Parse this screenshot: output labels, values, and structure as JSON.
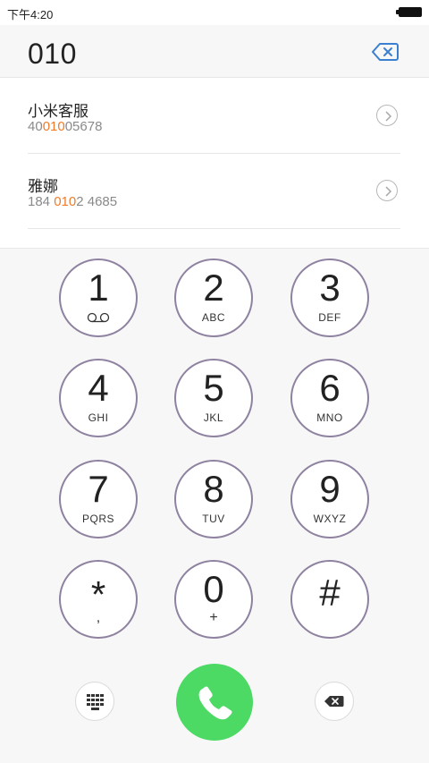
{
  "status_bar": {
    "time": "下午4:20"
  },
  "header": {
    "entered_number": "010"
  },
  "results": [
    {
      "name": "小米客服",
      "number_parts": [
        "40",
        "010",
        "05678"
      ]
    },
    {
      "name": "雅娜",
      "number_parts": [
        "184 ",
        "010",
        "2 4685"
      ]
    }
  ],
  "keypad": {
    "keys": [
      {
        "digit": "1",
        "letters": ""
      },
      {
        "digit": "2",
        "letters": "ABC"
      },
      {
        "digit": "3",
        "letters": "DEF"
      },
      {
        "digit": "4",
        "letters": "GHI"
      },
      {
        "digit": "5",
        "letters": "JKL"
      },
      {
        "digit": "6",
        "letters": "MNO"
      },
      {
        "digit": "7",
        "letters": "PQRS"
      },
      {
        "digit": "8",
        "letters": "TUV"
      },
      {
        "digit": "9",
        "letters": "WXYZ"
      },
      {
        "digit": "*",
        "letters": ","
      },
      {
        "digit": "0",
        "letters": "+"
      },
      {
        "digit": "#",
        "letters": ""
      }
    ]
  },
  "colors": {
    "highlight": "#f07b2b",
    "call": "#4cd964",
    "key_border": "#8e82a0",
    "accent": "#3a7fd0"
  }
}
